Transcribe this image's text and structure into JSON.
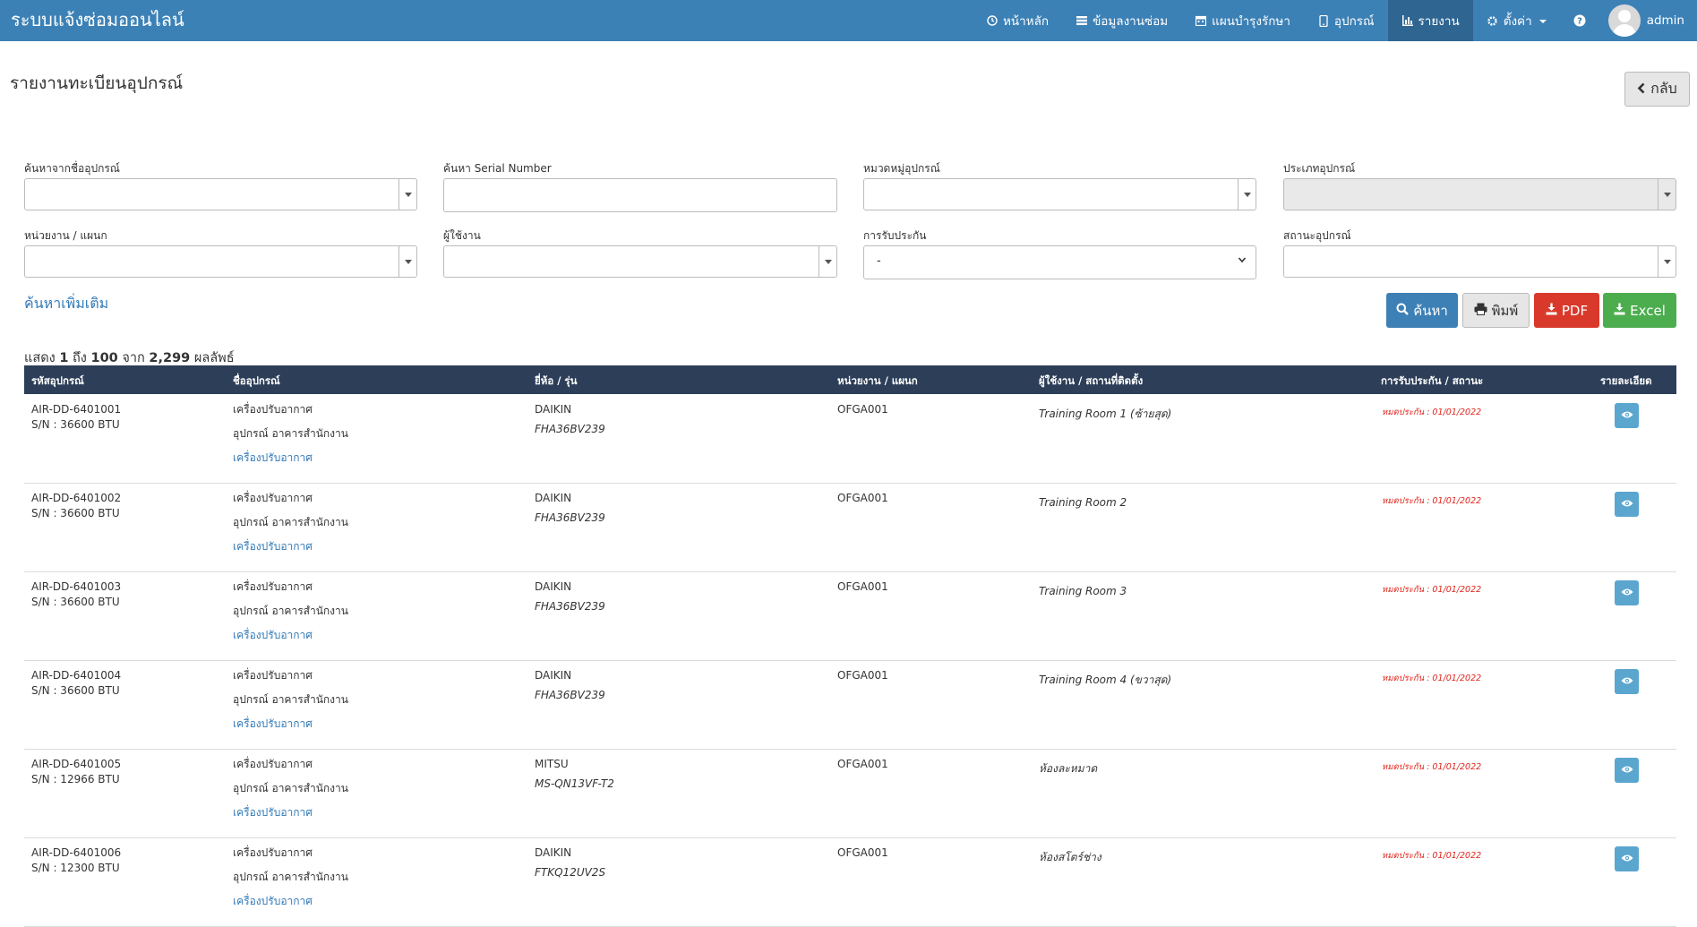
{
  "app": {
    "title": "ระบบแจ้งซ่อมออนไลน์"
  },
  "nav": {
    "items": [
      {
        "label": "หน้าหลัก",
        "icon": "clock-icon"
      },
      {
        "label": "ข้อมูลงานซ่อม",
        "icon": "list-icon"
      },
      {
        "label": "แผนบำรุงรักษา",
        "icon": "calendar-icon"
      },
      {
        "label": "อุปกรณ์",
        "icon": "mobile-icon"
      },
      {
        "label": "รายงาน",
        "icon": "bar-chart-icon",
        "active": true
      },
      {
        "label": "ตั้งค่า",
        "icon": "gear-icon"
      }
    ],
    "user": "admin"
  },
  "page": {
    "title": "รายงานทะเบียนอุปกรณ์",
    "back_label": "กลับ"
  },
  "filters": {
    "device_name_label": "ค้นหาจากชื่ออุปกรณ์",
    "serial_label": "ค้นหา Serial Number",
    "category_label": "หมวดหมู่อุปกรณ์",
    "type_label": "ประเภทอุปกรณ์",
    "department_label": "หน่วยงาน / แผนก",
    "user_label": "ผู้ใช้งาน",
    "warranty_label": "การรับประกัน",
    "warranty_value": "-",
    "status_label": "สถานะอุปกรณ์",
    "more_search": "ค้นหาเพิ่มเติม"
  },
  "actions": {
    "search": "ค้นหา",
    "print": "พิมพ์",
    "pdf": "PDF",
    "excel": "Excel"
  },
  "summary": {
    "prefix": "แสดง",
    "from": "1",
    "to_word": "ถึง",
    "to": "100",
    "of_word": "จาก",
    "total": "2,299",
    "suffix": "ผลลัพธ์"
  },
  "table": {
    "headers": [
      "รหัสอุปกรณ์",
      "ชื่ออุปกรณ์",
      "ยี่ห้อ / รุ่น",
      "หน่วยงาน / แผนก",
      "ผู้ใช้งาน / สถานที่ติดตั้ง",
      "การรับประกัน / สถานะ",
      "รายละเอียด"
    ],
    "rows": [
      {
        "code": "AIR-DD-6401001",
        "sn": "S/N : 36600 BTU",
        "name": "เครื่องปรับอากาศ",
        "group": "อุปกรณ์ อาคารสำนักงาน",
        "category": "เครื่องปรับอากาศ",
        "brand": "DAIKIN",
        "model": "FHA36BV239",
        "dept": "OFGA001",
        "location": "Training Room 1 (ซ้ายสุด)",
        "warranty": "หมดประกัน : 01/01/2022"
      },
      {
        "code": "AIR-DD-6401002",
        "sn": "S/N : 36600 BTU",
        "name": "เครื่องปรับอากาศ",
        "group": "อุปกรณ์ อาคารสำนักงาน",
        "category": "เครื่องปรับอากาศ",
        "brand": "DAIKIN",
        "model": "FHA36BV239",
        "dept": "OFGA001",
        "location": "Training Room 2",
        "warranty": "หมดประกัน : 01/01/2022"
      },
      {
        "code": "AIR-DD-6401003",
        "sn": "S/N : 36600 BTU",
        "name": "เครื่องปรับอากาศ",
        "group": "อุปกรณ์ อาคารสำนักงาน",
        "category": "เครื่องปรับอากาศ",
        "brand": "DAIKIN",
        "model": "FHA36BV239",
        "dept": "OFGA001",
        "location": "Training Room 3",
        "warranty": "หมดประกัน : 01/01/2022"
      },
      {
        "code": "AIR-DD-6401004",
        "sn": "S/N : 36600 BTU",
        "name": "เครื่องปรับอากาศ",
        "group": "อุปกรณ์ อาคารสำนักงาน",
        "category": "เครื่องปรับอากาศ",
        "brand": "DAIKIN",
        "model": "FHA36BV239",
        "dept": "OFGA001",
        "location": "Training Room 4 (ขวาสุด)",
        "warranty": "หมดประกัน : 01/01/2022"
      },
      {
        "code": "AIR-DD-6401005",
        "sn": "S/N : 12966 BTU",
        "name": "เครื่องปรับอากาศ",
        "group": "อุปกรณ์ อาคารสำนักงาน",
        "category": "เครื่องปรับอากาศ",
        "brand": "MITSU",
        "model": "MS-QN13VF-T2",
        "dept": "OFGA001",
        "location": "ห้องละหมาด",
        "warranty": "หมดประกัน : 01/01/2022"
      },
      {
        "code": "AIR-DD-6401006",
        "sn": "S/N : 12300 BTU",
        "name": "เครื่องปรับอากาศ",
        "group": "อุปกรณ์ อาคารสำนักงาน",
        "category": "เครื่องปรับอากาศ",
        "brand": "DAIKIN",
        "model": "FTKQ12UV2S",
        "dept": "OFGA001",
        "location": "ห้องสโตร์ช่าง",
        "warranty": "หมดประกัน : 01/01/2022"
      }
    ]
  },
  "colors": {
    "navbar": "#3c81b6",
    "nav_active": "#2f6591",
    "table_header": "#2d3e58",
    "pdf": "#d9392b",
    "excel": "#4cad4f",
    "warranty": "#e0241a"
  }
}
